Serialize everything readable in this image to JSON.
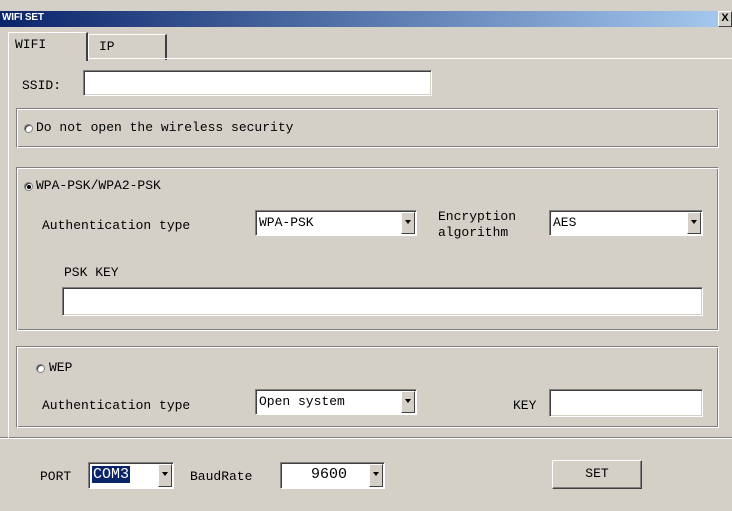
{
  "window": {
    "title": "WIFI SET",
    "close_label": "X"
  },
  "tabs": [
    {
      "label": "WIFI",
      "active": true
    },
    {
      "label": "IP",
      "active": false
    }
  ],
  "ssid": {
    "label": "SSID:",
    "value": ""
  },
  "no_security": {
    "label": "Do not open the wireless security",
    "selected": false
  },
  "wpa": {
    "label": "WPA-PSK/WPA2-PSK",
    "selected": true,
    "auth_label": "Authentication type",
    "auth_value": "WPA-PSK",
    "enc_label_line1": "Encryption",
    "enc_label_line2": "algorithm",
    "enc_value": "AES",
    "psk_label": "PSK KEY",
    "psk_value": ""
  },
  "wep": {
    "label": "WEP",
    "selected": false,
    "auth_label": "Authentication type",
    "auth_value": "Open system",
    "key_label": "KEY",
    "key_value": ""
  },
  "footer": {
    "port_label": "PORT",
    "port_value": "COM3",
    "baud_label": "BaudRate",
    "baud_value": "9600",
    "set_label": "SET"
  }
}
